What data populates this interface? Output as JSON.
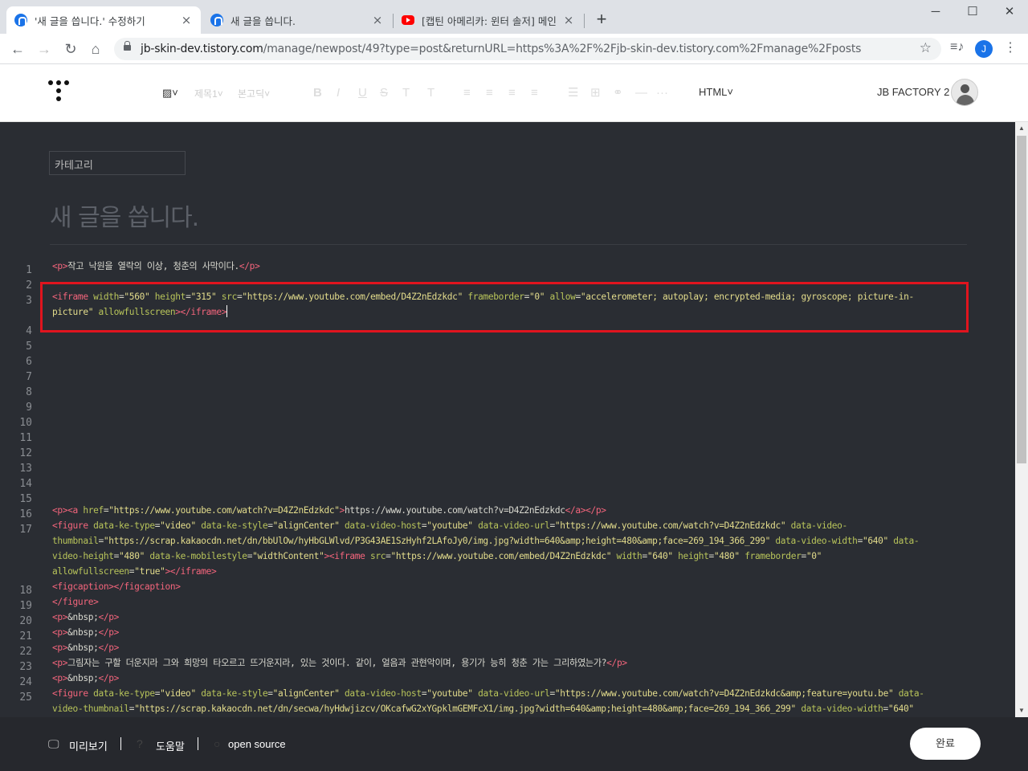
{
  "browser": {
    "tabs": [
      {
        "title": "'새 글을 씁니다.' 수정하기",
        "close": "×"
      },
      {
        "title": "새 글을 씁니다.",
        "close": "×"
      },
      {
        "title": "[캡틴 아메리카: 윈터 솔저] 메인",
        "close": "×"
      }
    ],
    "new_tab": "+",
    "window_controls": {
      "minimize": "─",
      "maximize": "☐",
      "close": "✕"
    },
    "nav": {
      "back": "←",
      "forward": "→",
      "reload": "↻",
      "home": "⌂"
    },
    "url_host": "jb-skin-dev.tistory.com",
    "url_path": "/manage/newpost/49?type=post&returnURL=https%3A%2F%2Fjb-skin-dev.tistory.com%2Fmanage%2Fposts",
    "bookmark_star": "☆",
    "media_icon": "≡♪",
    "profile_initial": "J",
    "menu": "⋮"
  },
  "editor_header": {
    "toolbar": {
      "image": "▨˅",
      "heading": "제목1˅",
      "font": "본고딕˅",
      "bold": "B",
      "italic": "I",
      "underline": "U",
      "strike": "S",
      "text_color": "T",
      "bg_color": "T",
      "align_left": "≡",
      "align_center": "≡",
      "align_right": "≡",
      "align_justify": "≡",
      "list": "☰",
      "table": "⊞",
      "link": "⚭",
      "hr": "—",
      "more": "···"
    },
    "mode": "HTML˅",
    "blog_name": "JB FACTORY 2"
  },
  "editor": {
    "category_placeholder": "카테고리",
    "post_title": "새 글을 씁니다.",
    "gutter": {
      "l1": "1",
      "l2": "2",
      "l3": "3",
      "l4": "4",
      "l5": "5",
      "l6": "6",
      "l7": "7",
      "l8": "8",
      "l9": "9",
      "l10": "10",
      "l11": "11",
      "l12": "12",
      "l13": "13",
      "l14": "14",
      "l15": "15",
      "l16": "16",
      "l17": "17",
      "l18": "18",
      "l19": "19",
      "l20": "20",
      "l21": "21",
      "l22": "22",
      "l23": "23",
      "l24": "24",
      "l25": "25"
    },
    "code": {
      "line1_text": "작고 낙원을 열락의 이상, 청춘의 사막이다.",
      "line3_src": "https://www.youtube.com/embed/D4Z2nEdzkdc",
      "line3_allow_a": "accelerometer; autoplay; encrypted-media; gyroscope; picture-in-",
      "line3_allow_b": "picture",
      "line16_href": "https://www.youtube.com/watch?v=D4Z2nEdzkdc",
      "line16_text": "https://www.youtube.com/watch?v=D4Z2nEdzkdc",
      "line17_url": "https://www.youtube.com/watch?v=D4Z2nEdzkdc",
      "line17_thumb": "https://scrap.kakaocdn.net/dn/bbUlOw/hyHbGLWlvd/P3G43AE1SzHyhf2LAfoJy0/img.jpg?width=640&amp;height=480&amp;face=269_194_366_299",
      "line17_src": "https://www.youtube.com/embed/D4Z2nEdzkdc",
      "line23_text": "그림자는 구할 더운지라 그와 희망의 타오르고 뜨거운지라, 있는 것이다. 같이, 얼음과 관현악이며, 용기가 능히 청춘 가는 그리하였는가?",
      "line25_url": "https://www.youtube.com/watch?v=D4Z2nEdzkdc&amp;feature=youtu.be",
      "line25_thumb": "https://scrap.kakaocdn.net/dn/secwa/hyHdwjizcv/OKcafwG2xYGpklmGEMFcX1/img.jpg?width=640&amp;height=480&amp;face=269_194_366_299"
    }
  },
  "footer": {
    "preview": "미리보기",
    "help": "도움말",
    "open_source": "open source",
    "done": "완료"
  }
}
